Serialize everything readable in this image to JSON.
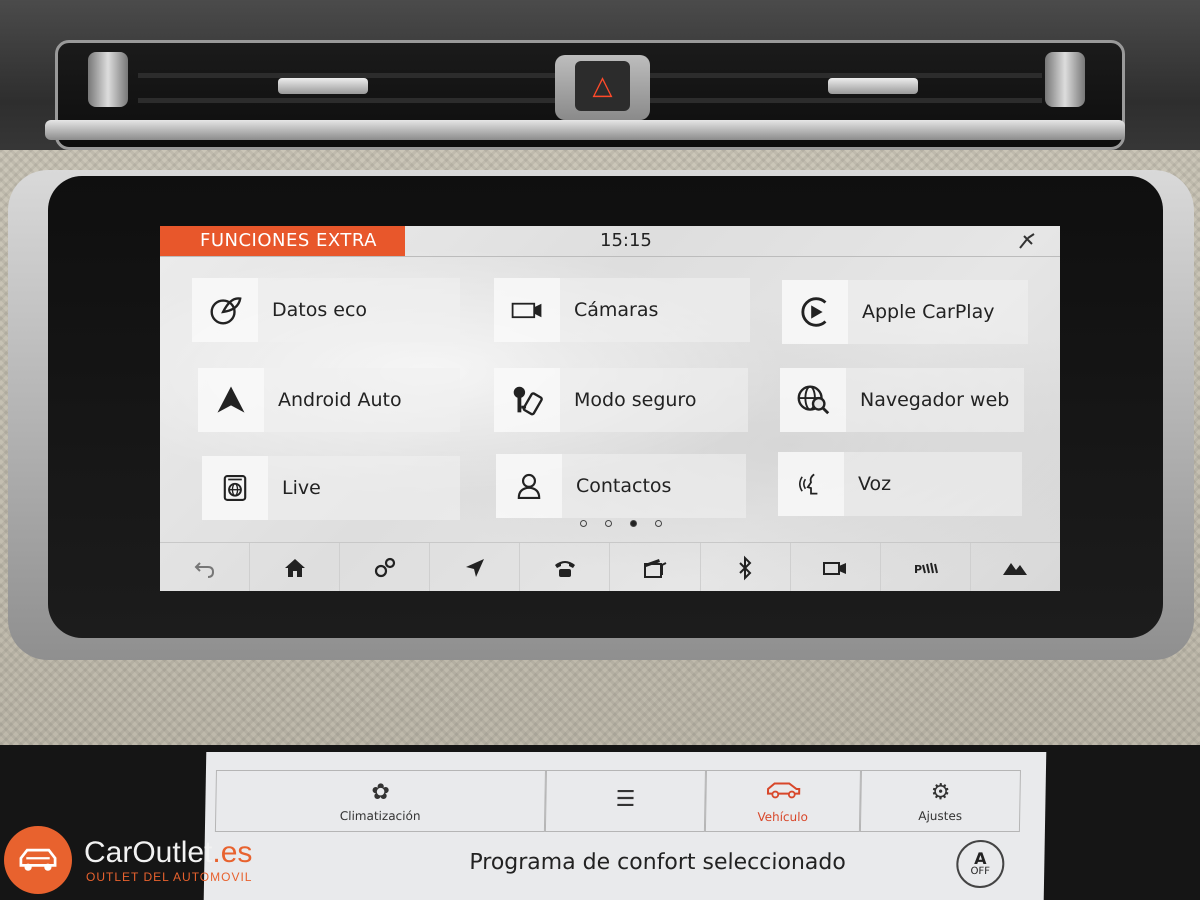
{
  "header": {
    "title": "FUNCIONES EXTRA",
    "clock": "15:15",
    "accent_color": "#e8572b"
  },
  "tiles": [
    {
      "label": "Datos eco",
      "icon": "eco-leaf-icon"
    },
    {
      "label": "Cámaras",
      "icon": "camera-icon"
    },
    {
      "label": "Apple CarPlay",
      "icon": "carplay-icon"
    },
    {
      "label": "Android Auto",
      "icon": "android-auto-icon"
    },
    {
      "label": "Modo seguro",
      "icon": "valet-key-icon"
    },
    {
      "label": "Navegador web",
      "icon": "web-browser-icon"
    },
    {
      "label": "Live",
      "icon": "live-icon"
    },
    {
      "label": "Contactos",
      "icon": "contact-icon"
    },
    {
      "label": "Voz",
      "icon": "voice-icon"
    }
  ],
  "pagination": {
    "pages": 4,
    "current": 3
  },
  "nav_bar": [
    "back-icon",
    "home-icon",
    "settings-icon",
    "navigation-icon",
    "phone-icon",
    "media-icon",
    "bluetooth-icon",
    "camera-icon",
    "parking-icon",
    "terrain-icon"
  ],
  "lower_screen": {
    "tabs": [
      {
        "label": "Climatización",
        "icon": "climate-icon"
      },
      {
        "label": "",
        "icon": "menu-lines-icon"
      },
      {
        "label": "Vehículo",
        "icon": "vehicle-icon"
      },
      {
        "label": "Ajustes",
        "icon": "settings-icon"
      }
    ],
    "active_tab_color": "#d8472a",
    "status_text": "Programa de confort seleccionado",
    "off_button": {
      "glyph": "A",
      "label": "OFF"
    }
  },
  "watermark": {
    "brand": "CarOutlet",
    "tld": ".es",
    "tagline": "OUTLET DEL AUTOMOVIL",
    "color": "#e8622e"
  }
}
